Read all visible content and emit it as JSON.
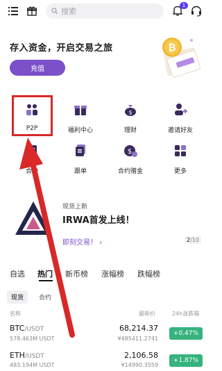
{
  "topbar": {
    "search_placeholder": "搜索",
    "notification_count": "1"
  },
  "hero": {
    "title": "存入资金，开启交易之旅",
    "deposit_label": "充值"
  },
  "grid": [
    {
      "label": "P2P",
      "icon": "p2p-users-icon"
    },
    {
      "label": "福利中心",
      "icon": "gift-icon"
    },
    {
      "label": "理财",
      "icon": "money-bag-icon"
    },
    {
      "label": "邀请好友",
      "icon": "invite-user-icon"
    },
    {
      "label": "合约",
      "icon": "contract-icon"
    },
    {
      "label": "跟单",
      "icon": "copy-trade-icon"
    },
    {
      "label": "合约赠金",
      "icon": "bonus-coin-icon"
    },
    {
      "label": "更多",
      "icon": "more-grid-icon"
    }
  ],
  "banner": {
    "new_listing": "现货上新",
    "title": "IRWA首发上线！",
    "link": "即刻交易！",
    "link_arrow": "›",
    "page_current": "2",
    "page_total": "/10"
  },
  "market_tabs": [
    "自选",
    "热门",
    "新币榜",
    "涨幅榜",
    "跌幅榜"
  ],
  "market_subtabs": [
    "现货",
    "合约"
  ],
  "columns": {
    "name": "名称",
    "price": "最新价",
    "change": "24h涨跌幅"
  },
  "rows": [
    {
      "base": "BTC",
      "quote": "/USDT",
      "volume": "578.463M USDT",
      "price": "68,214.37",
      "fiat": "¥485411.2741",
      "change": "+0.47%"
    },
    {
      "base": "ETH",
      "quote": "/USDT",
      "volume": "483.194M USDT",
      "price": "2,106.58",
      "fiat": "¥14990.3559",
      "change": "+1.87%"
    }
  ],
  "colors": {
    "accent": "#7b50c8",
    "positive": "#36b37e",
    "annotation": "#d92828"
  }
}
